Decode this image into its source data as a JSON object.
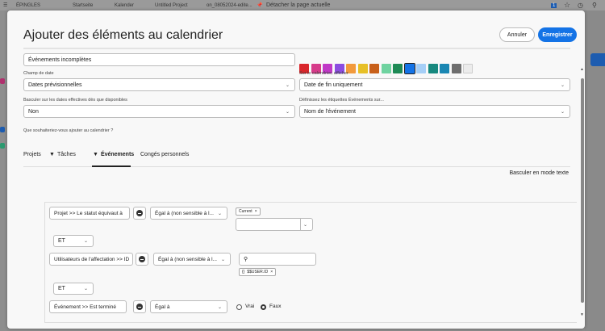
{
  "topbar": {
    "pins": "ÉPINGLES",
    "items": [
      "Startseite",
      "Kalender",
      "Untitled Project",
      "on_08052024-edite..."
    ],
    "detach": "Détacher la page actuelle",
    "badge": "1"
  },
  "modal": {
    "title": "Ajouter des éléments au calendrier",
    "cancel": "Annuler",
    "save": "Enregistrer",
    "name_value": "Événements incomplètes",
    "colors": [
      "#d9262b",
      "#d63b8a",
      "#c038c6",
      "#8c4de0",
      "#f29a3c",
      "#e7c027",
      "#c8601a",
      "#6fd3a0",
      "#1e8a55",
      "#1473e6",
      "#a6cff7",
      "#17897f",
      "#1a86b2",
      "#6e6e6e",
      "#ececec"
    ],
    "selected_color": "#1473e6",
    "date_field_label": "Champ de date",
    "date_field_value": "Dates prévisionnelles",
    "show_label": "Sur le calendrier, afficher",
    "show_value": "Date de fin uniquement",
    "switch_label": "Basculer sur les dates effectives dès que disponibles",
    "switch_value": "Non",
    "labels_label": "Définissez les étiquettes Événements sur...",
    "labels_value": "Nom de l'événement",
    "question": "Que souhaiteriez-vous ajouter au calendrier ?",
    "tabs": [
      "Projets",
      "Tâches",
      "Événements",
      "Congés personnels"
    ],
    "text_mode": "Basculer en mode texte",
    "filters": [
      {
        "field": "Projet  >>  Le statut équivaut à",
        "op": "Égal à (non sensible à l...",
        "tag": "Current"
      },
      {
        "field": "Utilisateurs de l'affectation  >>  ID",
        "op": "Égal à (non sensible à l...",
        "tag": "$$USER.ID"
      },
      {
        "field": "Événement  >>  Est terminé",
        "op": "Égal à",
        "true": "Vrai",
        "false": "Faux"
      }
    ],
    "conjunction": "ET"
  }
}
